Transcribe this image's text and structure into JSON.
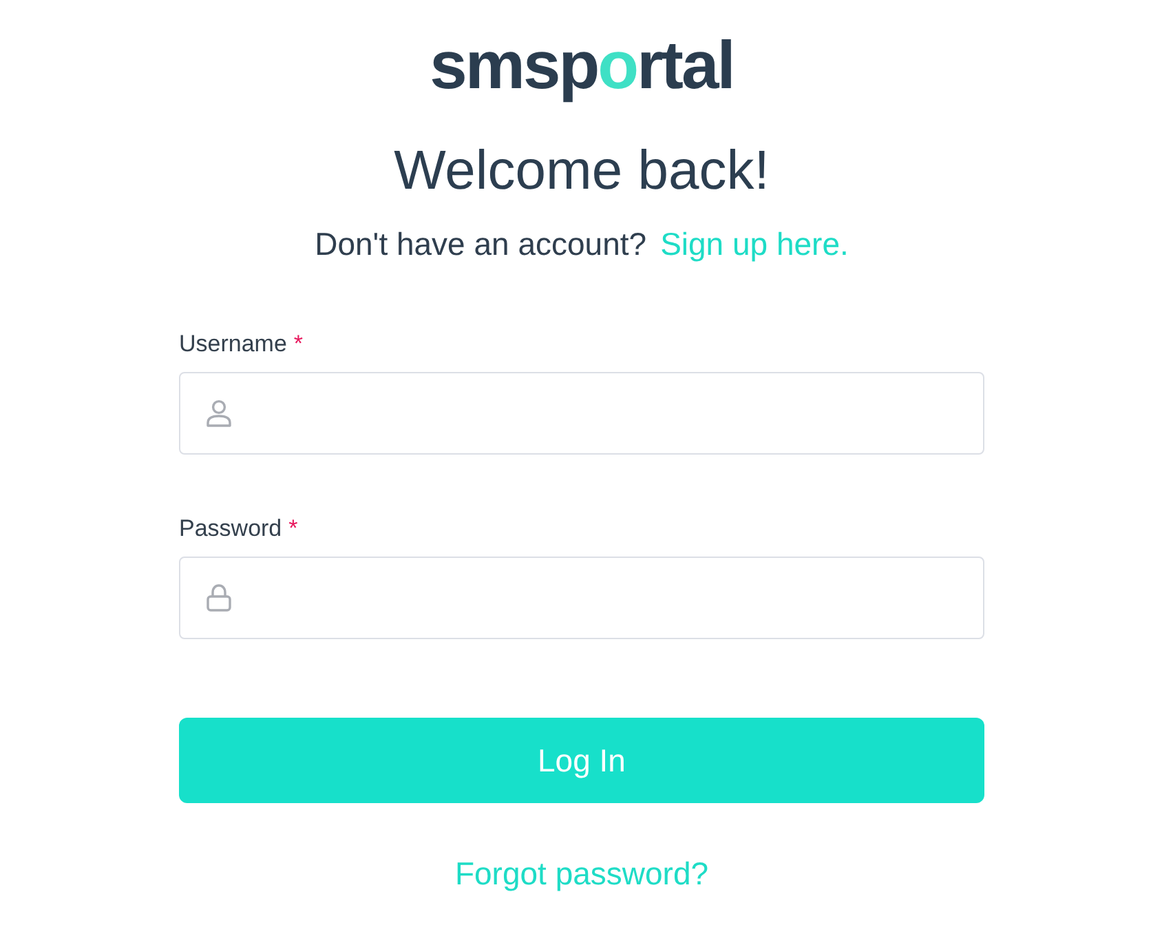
{
  "logo": {
    "parts": [
      {
        "text": "smsp",
        "accent": false
      },
      {
        "text": "o",
        "accent": true
      },
      {
        "text": "rtal",
        "accent": false
      }
    ]
  },
  "heading": "Welcome back!",
  "signup": {
    "prompt": "Don't have an account?",
    "link": "Sign up here."
  },
  "fields": [
    {
      "kind": "username",
      "label": "Username",
      "required_mark": "*"
    },
    {
      "kind": "password",
      "label": "Password",
      "required_mark": "*"
    }
  ],
  "submit_button": "Log In",
  "forgot_link": "Forgot password?"
}
